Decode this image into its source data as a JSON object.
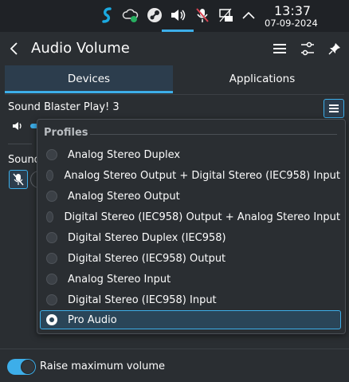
{
  "taskbar": {
    "icons": [
      "steam-s-icon",
      "cloud-sync-icon",
      "steam-icon",
      "speaker-icon",
      "mic-muted-icon",
      "network-icon",
      "tray-expand-icon"
    ],
    "time": "13:37",
    "date": "07-09-2024"
  },
  "header": {
    "title": "Audio Volume"
  },
  "tabs": [
    {
      "label": "Devices",
      "active": true
    },
    {
      "label": "Applications",
      "active": false
    }
  ],
  "device": {
    "name": "Sound Blaster Play! 3"
  },
  "second_section": {
    "label": "Sound"
  },
  "popup": {
    "header": "Profiles",
    "options": [
      {
        "label": "Analog Stereo Duplex",
        "selected": false
      },
      {
        "label": "Analog Stereo Output + Digital Stereo (IEC958) Input",
        "selected": false
      },
      {
        "label": "Analog Stereo Output",
        "selected": false
      },
      {
        "label": "Digital Stereo (IEC958) Output + Analog Stereo Input",
        "selected": false
      },
      {
        "label": "Digital Stereo Duplex (IEC958)",
        "selected": false
      },
      {
        "label": "Digital Stereo (IEC958) Output",
        "selected": false
      },
      {
        "label": "Analog Stereo Input",
        "selected": false
      },
      {
        "label": "Digital Stereo (IEC958) Input",
        "selected": false
      },
      {
        "label": "Pro Audio",
        "selected": true
      }
    ]
  },
  "footer": {
    "toggle_label": "Raise maximum volume",
    "toggle_on": true
  },
  "colors": {
    "accent": "#3daee9",
    "background": "#2a2e32",
    "taskbar": "#1f2226"
  }
}
